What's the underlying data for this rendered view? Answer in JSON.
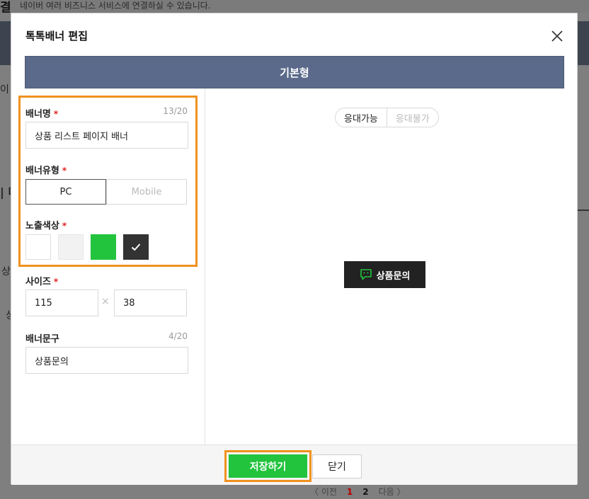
{
  "background": {
    "hint": "네이버 여러 비즈니스 서비스에 연결하실 수 있습니다.",
    "title_fragment": "결",
    "fragments": [
      "이",
      "| 더",
      "상",
      "상"
    ],
    "pager": {
      "prev": "〈 이전",
      "page1": "1",
      "page2": "2",
      "next": "다음 〉"
    }
  },
  "modal": {
    "title": "톡톡배너 편집",
    "tab": "기본형",
    "fields": {
      "name": {
        "label": "배너명",
        "counter": "13/20",
        "value": "상품 리스트 페이지 배너"
      },
      "type": {
        "label": "배너유형",
        "options": [
          "PC",
          "Mobile"
        ],
        "selected": "PC"
      },
      "color": {
        "label": "노출색상",
        "swatches": [
          "#ffffff",
          "#f2f2f2",
          "#22c33d",
          "#333333"
        ],
        "selected_index": 3
      },
      "size": {
        "label": "사이즈",
        "width": "115",
        "height": "38",
        "separator": "×"
      },
      "text": {
        "label": "배너문구",
        "counter": "4/20",
        "value": "상품문의"
      }
    },
    "required_mark": "*",
    "preview": {
      "status_options": [
        "응대가능",
        "응대불가"
      ],
      "selected_status": "응대가능",
      "banner_text": "상품문의",
      "banner_icon": "chat-bubble-icon"
    },
    "footer": {
      "save_label": "저장하기",
      "close_label": "닫기"
    }
  },
  "colors": {
    "accent_green": "#22c33d",
    "tab_bg": "#5b6a8a",
    "highlight": "#f0921f",
    "required": "#e02020"
  }
}
